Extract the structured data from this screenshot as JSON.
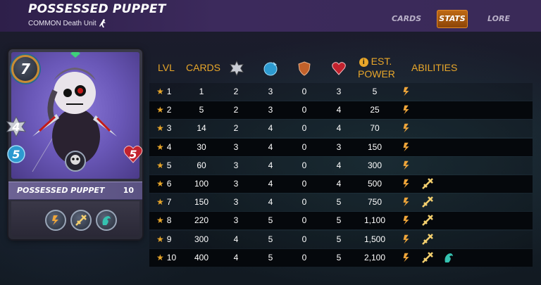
{
  "header": {
    "title": "POSSESSED PUPPET",
    "subtitle": "COMMON Death Unit"
  },
  "tabs": [
    {
      "label": "CARDS",
      "active": false
    },
    {
      "label": "STATS",
      "active": true
    },
    {
      "label": "LORE",
      "active": false
    }
  ],
  "card": {
    "name": "POSSESSED PUPPET",
    "level": "10",
    "mana": "7",
    "attack": "4",
    "speed": "5",
    "health": "5",
    "abilities": [
      "slow-ability-icon",
      "trample-ability-icon",
      "cleanse-ability-icon"
    ]
  },
  "table": {
    "headers": {
      "lvl": "LVL",
      "cards": "CARDS",
      "est": "EST.",
      "power": "POWER",
      "abilities": "ABILITIES"
    },
    "header_icons": [
      "melee-attack-icon",
      "speed-icon",
      "armor-icon",
      "health-icon",
      "info-icon"
    ],
    "rows": [
      {
        "lvl": "1",
        "cards": "1",
        "attack": "2",
        "speed": "3",
        "armor": "0",
        "health": "3",
        "power": "5",
        "abilities": [
          "slow"
        ]
      },
      {
        "lvl": "2",
        "cards": "5",
        "attack": "2",
        "speed": "3",
        "armor": "0",
        "health": "4",
        "power": "25",
        "abilities": [
          "slow"
        ]
      },
      {
        "lvl": "3",
        "cards": "14",
        "attack": "2",
        "speed": "4",
        "armor": "0",
        "health": "4",
        "power": "70",
        "abilities": [
          "slow"
        ]
      },
      {
        "lvl": "4",
        "cards": "30",
        "attack": "3",
        "speed": "4",
        "armor": "0",
        "health": "3",
        "power": "150",
        "abilities": [
          "slow"
        ]
      },
      {
        "lvl": "5",
        "cards": "60",
        "attack": "3",
        "speed": "4",
        "armor": "0",
        "health": "4",
        "power": "300",
        "abilities": [
          "slow"
        ]
      },
      {
        "lvl": "6",
        "cards": "100",
        "attack": "3",
        "speed": "4",
        "armor": "0",
        "health": "4",
        "power": "500",
        "abilities": [
          "slow",
          "trample"
        ]
      },
      {
        "lvl": "7",
        "cards": "150",
        "attack": "3",
        "speed": "4",
        "armor": "0",
        "health": "5",
        "power": "750",
        "abilities": [
          "slow",
          "trample"
        ]
      },
      {
        "lvl": "8",
        "cards": "220",
        "attack": "3",
        "speed": "5",
        "armor": "0",
        "health": "5",
        "power": "1,100",
        "abilities": [
          "slow",
          "trample"
        ]
      },
      {
        "lvl": "9",
        "cards": "300",
        "attack": "4",
        "speed": "5",
        "armor": "0",
        "health": "5",
        "power": "1,500",
        "abilities": [
          "slow",
          "trample"
        ]
      },
      {
        "lvl": "10",
        "cards": "400",
        "attack": "4",
        "speed": "5",
        "armor": "0",
        "health": "5",
        "power": "2,100",
        "abilities": [
          "slow",
          "trample",
          "cleanse"
        ]
      }
    ]
  },
  "colors": {
    "accent": "#e9a72a",
    "header_bg": "#3a2a58",
    "tab_active": "#b35f0f"
  }
}
